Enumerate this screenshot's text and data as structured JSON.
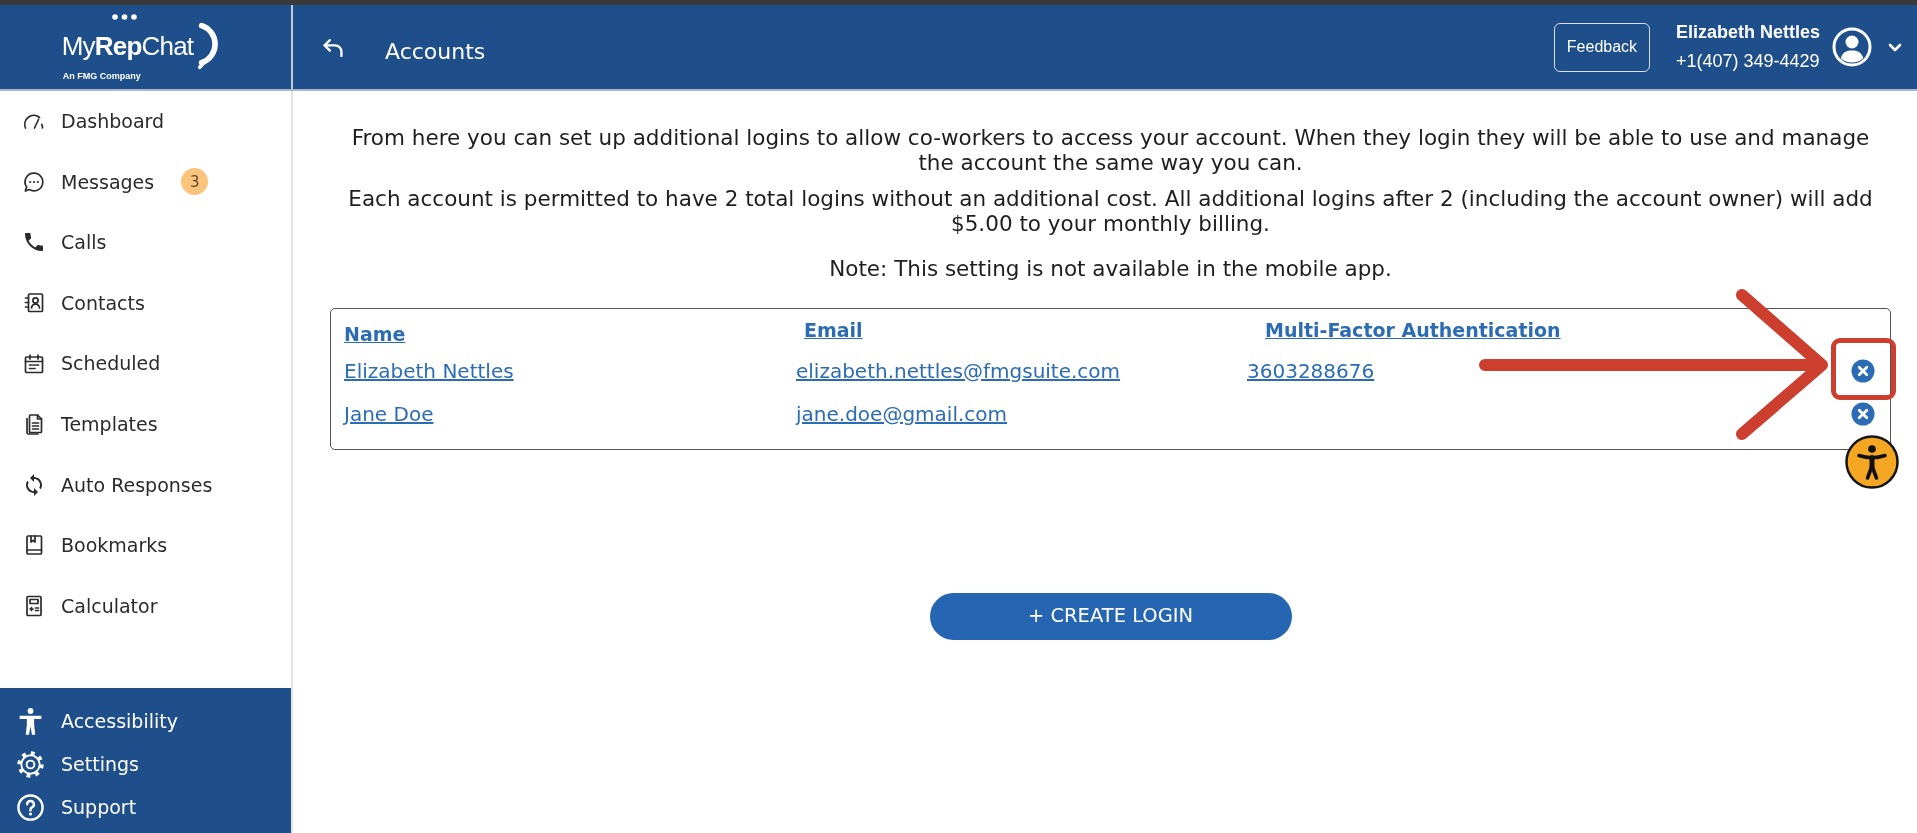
{
  "logo": {
    "wordmark": "My**Rep**Chat",
    "tagline": "An FMG Company"
  },
  "header": {
    "title": "Accounts",
    "feedback_button": "Feedback",
    "user": {
      "name": "Elizabeth Nettles",
      "phone": "+1(407) 349-4429"
    }
  },
  "sidebar": {
    "items": [
      {
        "label": "Dashboard",
        "selected": false
      },
      {
        "label": "Messages",
        "badge": "3",
        "selected": false
      },
      {
        "label": "Calls",
        "selected": false
      },
      {
        "label": "Contacts",
        "selected": false
      },
      {
        "label": "Scheduled",
        "selected": false
      },
      {
        "label": "Templates",
        "selected": false
      },
      {
        "label": "Auto Responses",
        "selected": false
      },
      {
        "label": "Bookmarks",
        "selected": false
      },
      {
        "label": "Calculator",
        "selected": false
      }
    ],
    "footer_items": [
      {
        "label": "Accessibility"
      },
      {
        "label": "Settings"
      },
      {
        "label": "Support"
      }
    ]
  },
  "content": {
    "paragraphs": [
      "From here you can set up additional logins to allow co-workers to access your account. When they login they will be able to use and manage the account the same way you can.",
      "Each account is permitted to have 2 total logins without an additional cost. All additional logins after 2 (including the account owner) will add $5.00 to your monthly billing.",
      "Note: This setting is not available in the mobile app."
    ],
    "logins_table": {
      "columns": [
        "Name",
        "Email",
        "Multi-Factor Authentication"
      ],
      "rows": [
        {
          "name": "Elizabeth Nettles",
          "email": "elizabeth.nettles@fmgsuite.com",
          "mfa": "3603288676",
          "highlighted": true
        },
        {
          "name": "Jane Doe",
          "email": "jane.doe@gmail.com",
          "highlighted": false
        }
      ]
    },
    "create_button": "+ CREATE LOGIN"
  }
}
